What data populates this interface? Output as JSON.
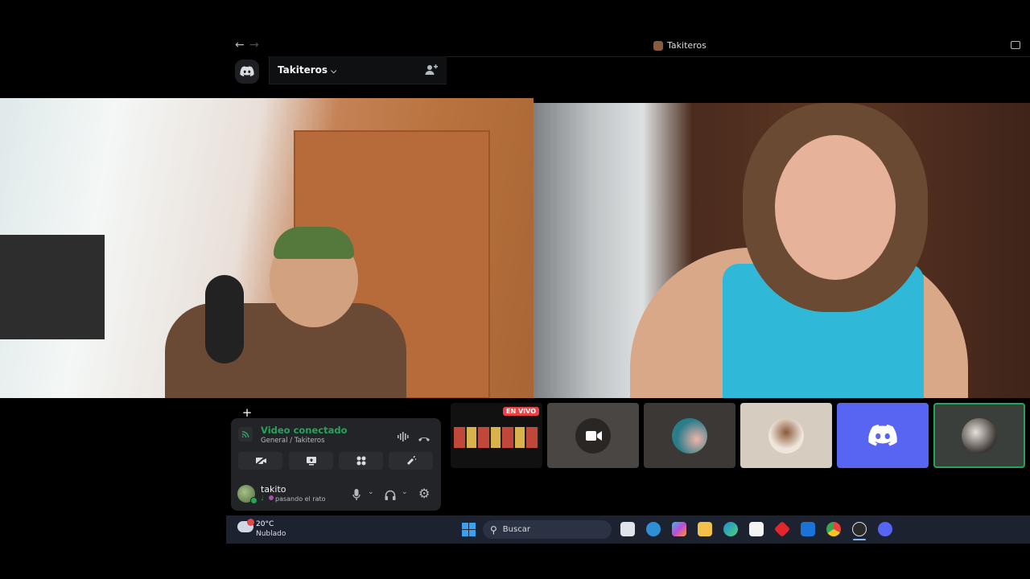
{
  "window": {
    "title": "Takiteros"
  },
  "server": {
    "name": "Takiteros"
  },
  "call": {
    "live_badge": "EN VIVO",
    "plus_symbol": "+"
  },
  "voice_panel": {
    "status": "Video conectado",
    "channel": "General / Takiteros"
  },
  "user": {
    "name": "takito",
    "status": "pasando el rato"
  },
  "taskbar": {
    "temperature": "20°C",
    "weather": "Nublado",
    "search_placeholder": "Buscar"
  },
  "colors": {
    "discord_blurple": "#5865f2",
    "connected_green": "#23a55a",
    "live_red": "#ed4245"
  }
}
